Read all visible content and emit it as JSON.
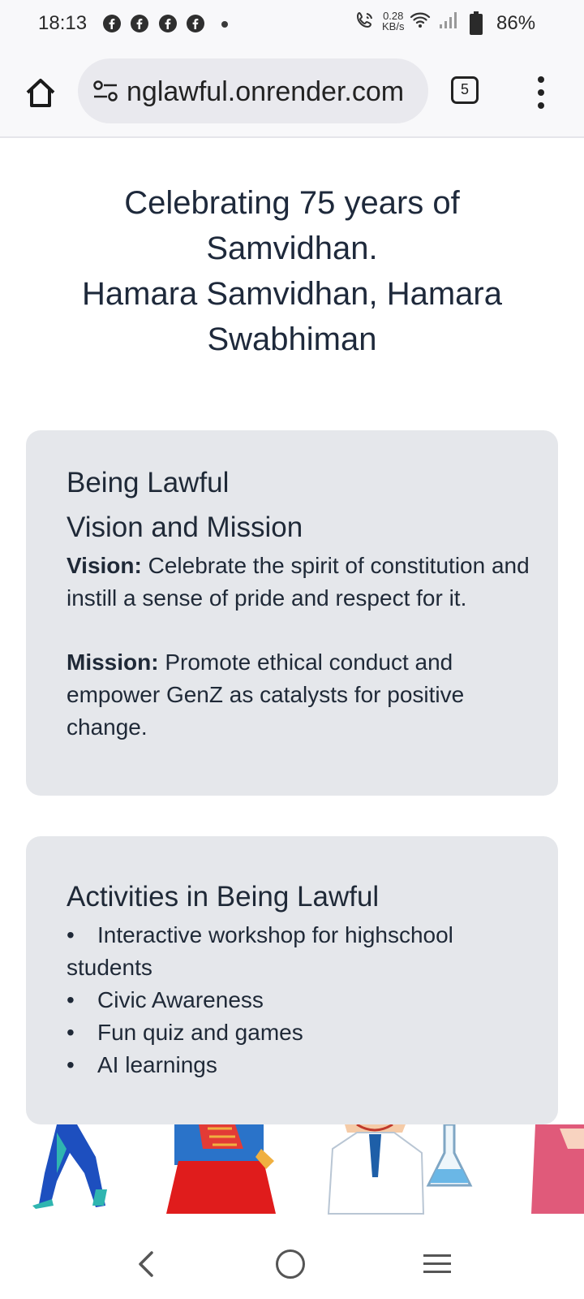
{
  "status_bar": {
    "time": "18:13",
    "net_speed_value": "0.28",
    "net_speed_unit": "KB/s",
    "battery": "86%",
    "notification_icons": [
      "facebook-icon",
      "facebook-icon",
      "facebook-icon",
      "facebook-icon"
    ]
  },
  "browser": {
    "url": "nglawful.onrender.com",
    "tab_count": "5"
  },
  "page": {
    "heading_lines": [
      "Celebrating 75 years of",
      "Samvidhan.",
      "Hamara Samvidhan, Hamara",
      "Swabhiman"
    ],
    "vision_card": {
      "title": "Being Lawful",
      "subtitle": "Vision and Mission",
      "vision_label": "Vision:",
      "vision_text": "Celebrate the spirit of constitution and instill a sense of pride and respect for it.",
      "mission_label": "Mission:",
      "mission_text": "Promote ethical conduct and empower GenZ as catalysts for positive change."
    },
    "activities_card": {
      "title": "Activities in Being Lawful",
      "items": [
        "Interactive workshop for highschool students",
        "Civic Awareness",
        "Fun quiz and games",
        "AI learnings"
      ]
    }
  },
  "colors": {
    "card_bg": "#e5e7eb",
    "heading": "#1e293b",
    "chrome_bg": "#f8f8fa",
    "url_pill": "#e9e9ee"
  }
}
